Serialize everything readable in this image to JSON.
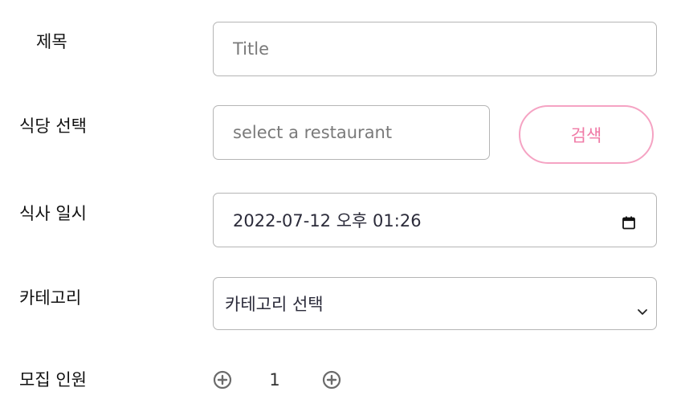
{
  "form": {
    "title": {
      "label": "제목",
      "placeholder": "Title"
    },
    "restaurant": {
      "label": "식당 선택",
      "placeholder": "select a restaurant",
      "search_label": "검색"
    },
    "datetime": {
      "label": "식사 일시",
      "value": "2022-07-12 오후 01:26"
    },
    "category": {
      "label": "카테고리",
      "selected": "카테고리 선택"
    },
    "recruit": {
      "label": "모집 인원",
      "count": "1"
    }
  },
  "colors": {
    "accent": "#f07aa6",
    "accent_border": "#f5a3c3",
    "field_border": "#b5b5b5"
  },
  "icons": {
    "calendar": "calendar-icon",
    "chevron": "chevron-down-icon",
    "decrement": "minus-circle-icon",
    "increment": "plus-circle-icon"
  }
}
